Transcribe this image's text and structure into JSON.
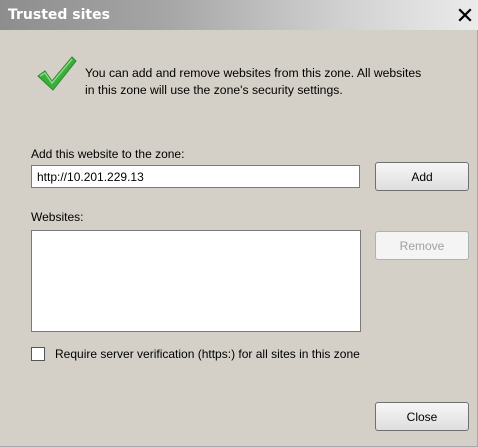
{
  "dialog": {
    "title": "Trusted sites",
    "close_glyph": "X",
    "info_icon": "green-checkmark-icon",
    "info_line1": "You can add and remove websites from this zone. All websites",
    "info_line2": "in this zone will use the zone's security settings.",
    "add_label": "Add this website to the zone:",
    "url_value": "http://10.201.229.13",
    "add_button": "Add",
    "websites_label": "Websites:",
    "websites": [],
    "remove_button": "Remove",
    "remove_enabled": false,
    "verify_label": "Require server verification (https:) for all sites in this zone",
    "verify_checked": false,
    "close_button": "Close"
  }
}
